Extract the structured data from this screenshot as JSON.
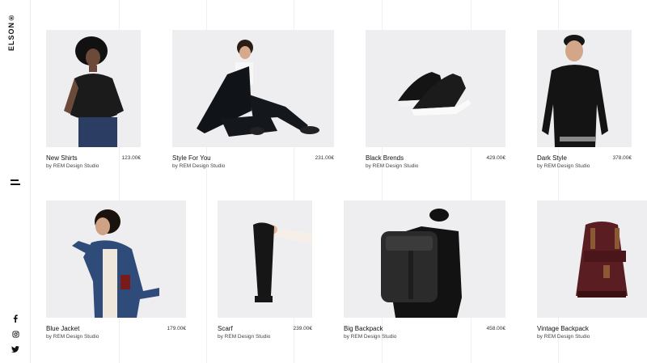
{
  "brand": {
    "name": "ELSON®"
  },
  "social": [
    {
      "icon": "facebook-icon"
    },
    {
      "icon": "instagram-icon"
    },
    {
      "icon": "twitter-icon"
    }
  ],
  "products": [
    {
      "name": "New Shirts",
      "by": "by REM Design Studio",
      "price": "123.00€"
    },
    {
      "name": "Style For You",
      "by": "by REM Design Studio",
      "price": "231.00€"
    },
    {
      "name": "Black Brends",
      "by": "by REM Design Studio",
      "price": "429.00€"
    },
    {
      "name": "Dark Style",
      "by": "by REM Design Studio",
      "price": "378.00€"
    },
    {
      "name": "Blue Jacket",
      "by": "by REM Design Studio",
      "price": "179.00€"
    },
    {
      "name": "Scarf",
      "by": "by REM Design Studio",
      "price": "239.00€"
    },
    {
      "name": "Big Backpack",
      "by": "by REM Design Studio",
      "price": "458.00€"
    },
    {
      "name": "Vintage Backpack",
      "by": "by REM Design Studio",
      "price": ""
    }
  ],
  "colors": {
    "image_bg": "#eeeef0",
    "text": "#111111",
    "accent_dark": "#1a1a1a",
    "backpack_brown": "#5a1e22"
  }
}
